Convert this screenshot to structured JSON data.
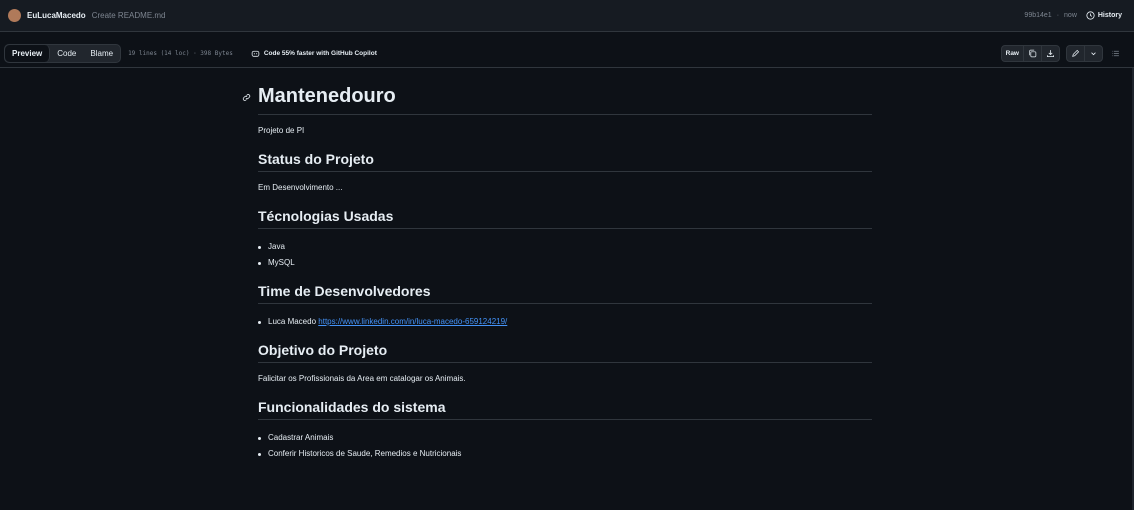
{
  "commit": {
    "author": "EuLucaMacedo",
    "message": "Create README.md",
    "hash": "99b14e1",
    "separator": "·",
    "time": "now",
    "history_label": "History"
  },
  "toolbar": {
    "tabs": [
      "Preview",
      "Code",
      "Blame"
    ],
    "file_info": "19 lines (14 loc) · 398 Bytes",
    "copilot_text": "Code 55% faster with GitHub Copilot",
    "raw_label": "Raw"
  },
  "readme": {
    "title": "Mantenedouro",
    "intro": "Projeto de PI",
    "sections": {
      "status": {
        "heading": "Status do Projeto",
        "text": "Em Desenvolvimento ..."
      },
      "tech": {
        "heading": "Técnologias Usadas",
        "items": [
          "Java",
          "MySQL"
        ]
      },
      "team": {
        "heading": "Time de Desenvolvedores",
        "member_name": "Luca Macedo",
        "member_link": "https://www.linkedin.com/in/luca-macedo-659124219/"
      },
      "goal": {
        "heading": "Objetivo do Projeto",
        "text": "Falicitar os Profissionais da Area em catalogar os Animais."
      },
      "features": {
        "heading": "Funcionalidades do sistema",
        "items": [
          "Cadastrar Animais",
          "Conferir Historicos de Saude, Remedios e Nutricionais"
        ]
      }
    }
  },
  "icons": {
    "anchor": "link-icon",
    "history": "clock-icon",
    "copilot": "copilot-icon",
    "copy": "copy-icon",
    "download": "download-icon",
    "edit": "pencil-icon",
    "dropdown": "chevron-down-icon",
    "outline": "list-icon"
  },
  "colors": {
    "background": "#0d1117",
    "header": "#161b22",
    "border": "#30363d",
    "text": "#e6edf3",
    "muted": "#7d8590",
    "link": "#4493f8"
  }
}
